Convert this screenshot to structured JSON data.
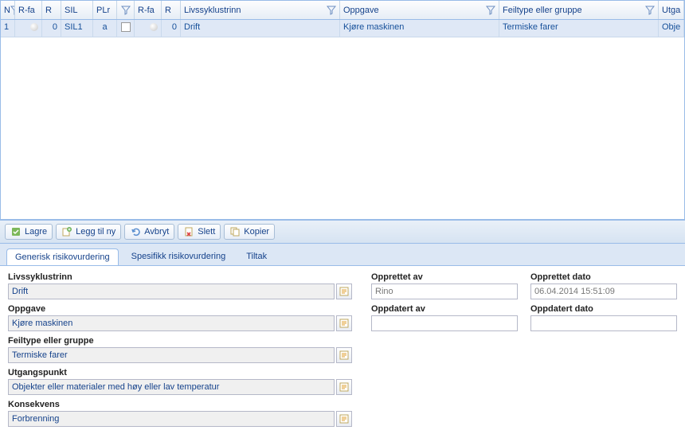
{
  "grid": {
    "headers": {
      "n": "N",
      "rfa1": "R-fa",
      "r1": "R",
      "sil": "SIL",
      "plr": "PLr",
      "chk": "",
      "rfa2": "R-fa",
      "r2": "R",
      "liv": "Livssyklustrinn",
      "opp": "Oppgave",
      "feil": "Feiltype eller gruppe",
      "utg": "Utga"
    },
    "row": {
      "n": "1",
      "r1": "0",
      "sil": "SIL1",
      "plr": "a",
      "r2": "0",
      "liv": "Drift",
      "opp": "Kjøre maskinen",
      "feil": "Termiske farer",
      "utg": "Obje"
    }
  },
  "toolbar": {
    "save": "Lagre",
    "add": "Legg til ny",
    "cancel": "Avbryt",
    "delete": "Slett",
    "copy": "Kopier"
  },
  "tabs": {
    "generic": "Generisk risikovurdering",
    "specific": "Spesifikk risikovurdering",
    "measures": "Tiltak"
  },
  "form": {
    "liv_label": "Livssyklustrinn",
    "liv": "Drift",
    "opp_label": "Oppgave",
    "opp": "Kjøre maskinen",
    "feil_label": "Feiltype eller gruppe",
    "feil": "Termiske farer",
    "utg_label": "Utgangspunkt",
    "utg": "Objekter eller materialer med høy eller lav temperatur",
    "kon_label": "Konsekvens",
    "kon": "Forbrenning",
    "created_by_label": "Opprettet av",
    "created_by": "Rino",
    "created_date_label": "Opprettet dato",
    "created_date": "06.04.2014 15:51:09",
    "updated_by_label": "Oppdatert av",
    "updated_by": "",
    "updated_date_label": "Oppdatert dato",
    "updated_date": ""
  }
}
